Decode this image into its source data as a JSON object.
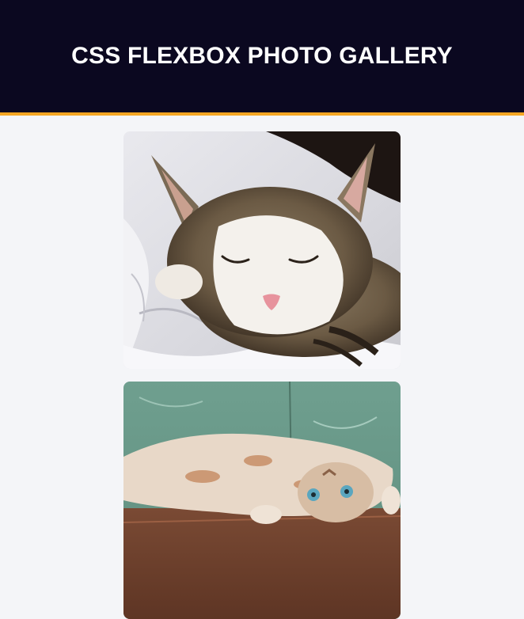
{
  "header": {
    "title": "CSS FLEXBOX PHOTO GALLERY",
    "accent_color": "#f5a623",
    "background_color": "#0b0820"
  },
  "gallery": {
    "photos": [
      {
        "subject": "sleeping-tabby-cat-on-white-blanket"
      },
      {
        "subject": "cat-lying-upside-down-on-wooden-floor"
      }
    ]
  }
}
